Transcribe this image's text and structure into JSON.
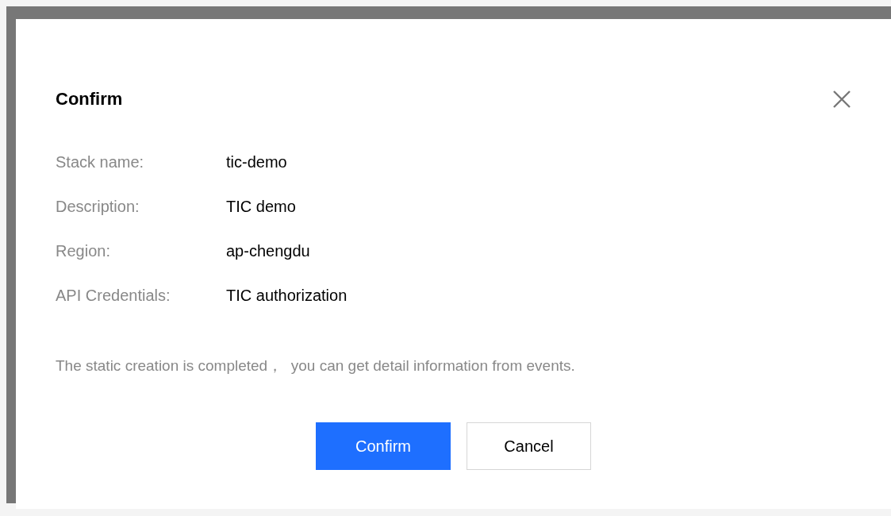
{
  "dialog": {
    "title": "Confirm",
    "fields": [
      {
        "label": "Stack name:",
        "value": "tic-demo"
      },
      {
        "label": "Description:",
        "value": "TIC demo"
      },
      {
        "label": "Region:",
        "value": "ap-chengdu"
      },
      {
        "label": "API Credentials:",
        "value": "TIC authorization"
      }
    ],
    "message": "The static creation is completed，  you can get detail information from events.",
    "buttons": [
      {
        "label": "Confirm",
        "kind": "primary"
      },
      {
        "label": "Cancel",
        "kind": "secondary"
      }
    ]
  }
}
